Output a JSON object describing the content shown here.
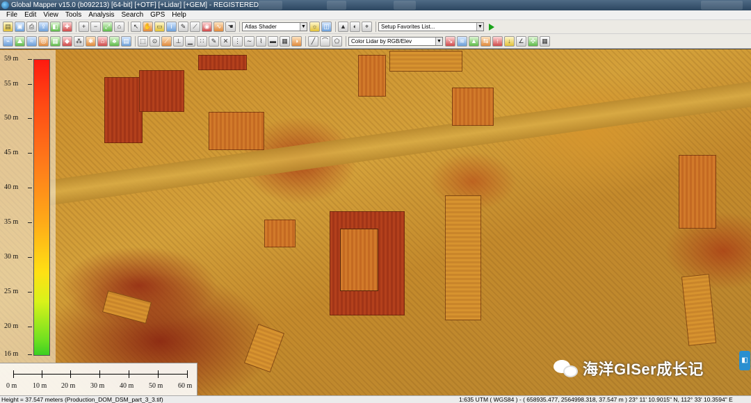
{
  "window": {
    "title": "Global Mapper v15.0 (b092213) [64-bit] [+OTF] [+Lidar] [+GEM] - REGISTERED"
  },
  "menu": [
    "File",
    "Edit",
    "View",
    "Tools",
    "Analysis",
    "Search",
    "GPS",
    "Help"
  ],
  "toolbar": {
    "shader_select": "Atlas Shader",
    "favorites_select": "Setup Favorites List...",
    "lidar_color_select": "Color Lidar by RGB/Elev"
  },
  "legend": {
    "ticks": [
      "59 m",
      "55 m",
      "50 m",
      "45 m",
      "40 m",
      "35 m",
      "30 m",
      "25 m",
      "20 m",
      "16 m"
    ],
    "max_color": "#ff1a10",
    "min_color": "#3ccf22"
  },
  "scale_bar": {
    "labels": [
      "0 m",
      "10 m",
      "20 m",
      "30 m",
      "40 m",
      "50 m",
      "60 m"
    ]
  },
  "watermark": {
    "text": "海洋GISer成长记"
  },
  "status": {
    "left": "Height = 37.547 meters (Production_DOM_DSM_part_3_3.tif)",
    "right": "1:635  UTM ( WGS84 ) - ( 658935.477, 2564998.318, 37.547 m )  23° 11' 10.9015\" N, 112° 33' 10.3594\" E"
  },
  "icons": [
    "app-icon",
    "open-icon",
    "save-icon",
    "print-icon",
    "zoom-in-icon",
    "zoom-out-icon",
    "pan-icon",
    "info-icon",
    "measure-icon",
    "3d-view-icon",
    "lidar-filter-icon",
    "play-icon",
    "wechat-icon"
  ]
}
